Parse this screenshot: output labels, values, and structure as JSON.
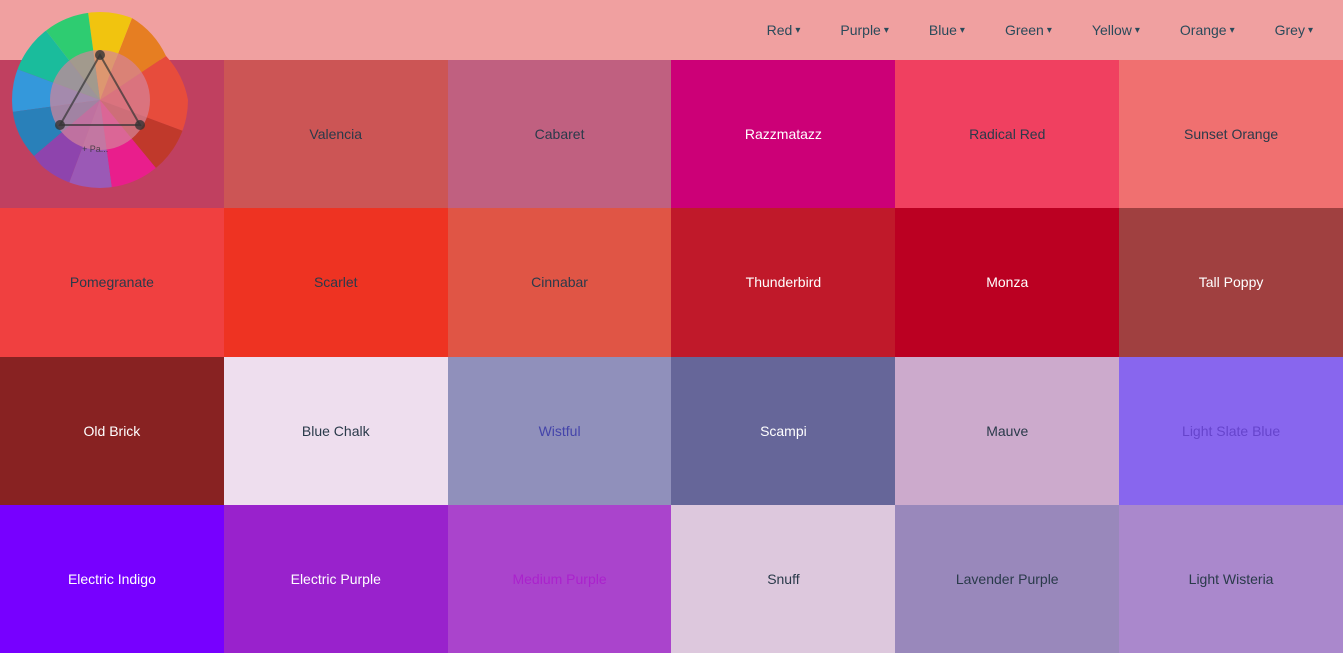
{
  "header": {
    "background": "#e8888a",
    "nav_items": [
      "Red",
      "Purple",
      "Blue",
      "Green",
      "Yellow",
      "Orange",
      "Grey"
    ]
  },
  "color_grid": [
    [
      {
        "name": "",
        "bg": "#c04060",
        "text": "#c04060",
        "text_visible": false
      },
      {
        "name": "Valencia",
        "bg": "#cc5555",
        "text": "#2a3a4a",
        "text_visible": true
      },
      {
        "name": "Cabaret",
        "bg": "#c06080",
        "text": "#2a3a4a",
        "text_visible": true
      },
      {
        "name": "Razzmatazz",
        "bg": "#cc0077",
        "text": "#ffffff",
        "text_visible": true
      },
      {
        "name": "Radical Red",
        "bg": "#f04060",
        "text": "#2a3a4a",
        "text_visible": true
      },
      {
        "name": "Sunset Orange",
        "bg": "#f07070",
        "text": "#2a3a4a",
        "text_visible": true
      }
    ],
    [
      {
        "name": "Pomegranate",
        "bg": "#f04040",
        "text": "#2a3a4a",
        "text_visible": true
      },
      {
        "name": "Scarlet",
        "bg": "#ee3322",
        "text": "#2a3a4a",
        "text_visible": true
      },
      {
        "name": "Cinnabar",
        "bg": "#e05545",
        "text": "#2a3a4a",
        "text_visible": true
      },
      {
        "name": "Thunderbird",
        "bg": "#c0192a",
        "text": "#ffffff",
        "text_visible": true
      },
      {
        "name": "Monza",
        "bg": "#bb0022",
        "text": "#ffffff",
        "text_visible": true
      },
      {
        "name": "Tall Poppy",
        "bg": "#a04040",
        "text": "#ffffff",
        "text_visible": true
      }
    ],
    [
      {
        "name": "Old Brick",
        "bg": "#882222",
        "text": "#ffffff",
        "text_visible": true
      },
      {
        "name": "Blue Chalk",
        "bg": "#eedeee",
        "text": "#2a3a4a",
        "text_visible": true
      },
      {
        "name": "Wistful",
        "bg": "#9090bb",
        "text": "#4444aa",
        "text_visible": true
      },
      {
        "name": "Scampi",
        "bg": "#666699",
        "text": "#ffffff",
        "text_visible": true
      },
      {
        "name": "Mauve",
        "bg": "#ccaacc",
        "text": "#2a3a4a",
        "text_visible": true
      },
      {
        "name": "Light Slate Blue",
        "bg": "#8866ee",
        "text": "#6644cc",
        "text_visible": true
      }
    ],
    [
      {
        "name": "Electric Indigo",
        "bg": "#7700ff",
        "text": "#ffffff",
        "text_visible": true
      },
      {
        "name": "Electric Purple",
        "bg": "#9922cc",
        "text": "#ffffff",
        "text_visible": true
      },
      {
        "name": "Medium Purple",
        "bg": "#aa44cc",
        "text": "#aa22cc",
        "text_visible": true
      },
      {
        "name": "Snuff",
        "bg": "#ddc8dd",
        "text": "#2a3a4a",
        "text_visible": true
      },
      {
        "name": "Lavender Purple",
        "bg": "#9988bb",
        "text": "#2a3a4a",
        "text_visible": true
      },
      {
        "name": "Light Wisteria",
        "bg": "#aa88cc",
        "text": "#2a3a4a",
        "text_visible": true
      }
    ]
  ]
}
